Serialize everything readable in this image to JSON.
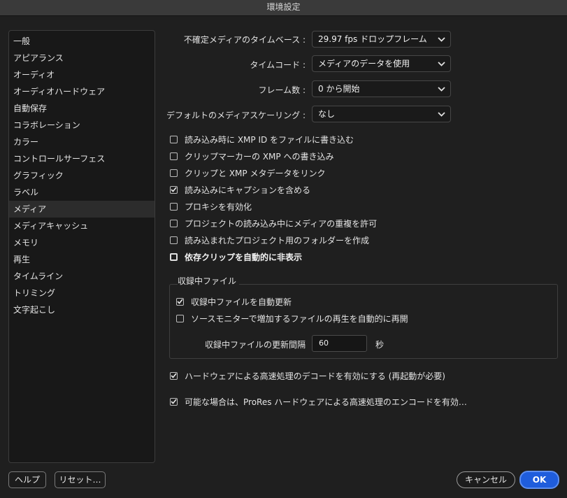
{
  "window": {
    "title": "環境設定"
  },
  "sidebar": {
    "items": [
      {
        "label": "一般"
      },
      {
        "label": "アピアランス"
      },
      {
        "label": "オーディオ"
      },
      {
        "label": "オーディオハードウェア"
      },
      {
        "label": "自動保存"
      },
      {
        "label": "コラボレーション"
      },
      {
        "label": "カラー"
      },
      {
        "label": "コントロールサーフェス"
      },
      {
        "label": "グラフィック"
      },
      {
        "label": "ラベル"
      },
      {
        "label": "メディア",
        "selected": true
      },
      {
        "label": "メディアキャッシュ"
      },
      {
        "label": "メモリ"
      },
      {
        "label": "再生"
      },
      {
        "label": "タイムライン"
      },
      {
        "label": "トリミング"
      },
      {
        "label": "文字起こし"
      }
    ]
  },
  "settings": {
    "timebase": {
      "label": "不確定メディアのタイムベース :",
      "value": "29.97 fps ドロップフレーム"
    },
    "timecode": {
      "label": "タイムコード :",
      "value": "メディアのデータを使用"
    },
    "frame_count": {
      "label": "フレーム数 :",
      "value": "0 から開始"
    },
    "scaling": {
      "label": "デフォルトのメディアスケーリング :",
      "value": "なし"
    }
  },
  "checkboxes": [
    {
      "label": "読み込み時に XMP ID をファイルに書き込む",
      "checked": false
    },
    {
      "label": "クリップマーカーの XMP への書き込み",
      "checked": false
    },
    {
      "label": "クリップと XMP メタデータをリンク",
      "checked": false
    },
    {
      "label": "読み込みにキャプションを含める",
      "checked": true
    },
    {
      "label": "プロキシを有効化",
      "checked": false
    },
    {
      "label": "プロジェクトの読み込み中にメディアの重複を許可",
      "checked": false
    },
    {
      "label": "読み込まれたプロジェクト用のフォルダーを作成",
      "checked": false
    },
    {
      "label": "依存クリップを自動的に非表示",
      "checked": false,
      "emphasis": true
    }
  ],
  "growing_files": {
    "title": "収録中ファイル",
    "auto_refresh": {
      "label": "収録中ファイルを自動更新",
      "checked": true
    },
    "resume_playback": {
      "label": "ソースモニターで増加するファイルの再生を自動的に再開",
      "checked": false
    },
    "interval_label": "収録中ファイルの更新間隔",
    "interval_value": "60",
    "interval_unit": "秒"
  },
  "hardware": {
    "decode": {
      "label": "ハードウェアによる高速処理のデコードを有効にする (再起動が必要)",
      "checked": true
    },
    "prores": {
      "label": "可能な場合は、ProRes ハードウェアによる高速処理のエンコードを有効…",
      "checked": true
    }
  },
  "footer": {
    "help_label": "ヘルプ",
    "reset_label": "リセット…",
    "cancel_label": "キャンセル",
    "ok_label": "OK"
  },
  "icons": {
    "dropdown": "chevron-down-icon",
    "check": "checkmark-icon"
  }
}
